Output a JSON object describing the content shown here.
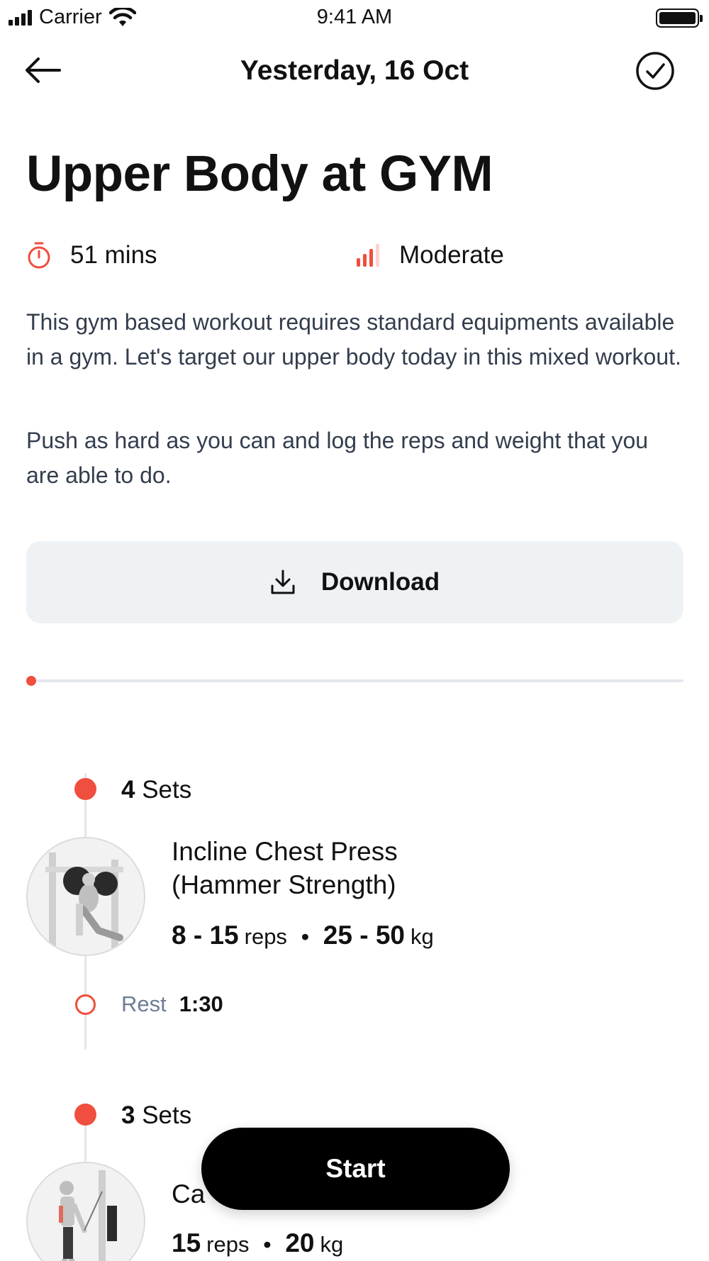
{
  "status_bar": {
    "carrier": "Carrier",
    "time": "9:41 AM"
  },
  "nav": {
    "title": "Yesterday, 16 Oct"
  },
  "workout": {
    "title": "Upper Body at GYM",
    "duration": "51 mins",
    "level": "Moderate",
    "description_1": "This gym based workout requires standard equipments available in a gym. Let's target our upper body today in this mixed workout.",
    "description_2": "Push as hard as you can and log the reps and weight that you are able to do."
  },
  "actions": {
    "download_label": "Download",
    "start_label": "Start"
  },
  "progress": {
    "fraction": 0.0
  },
  "exercises": [
    {
      "sets_count": "4",
      "sets_label": "Sets",
      "name": "Incline Chest Press (Hammer Strength)",
      "reps": "8 - 15",
      "reps_unit": "reps",
      "separator": "•",
      "weight": "25 - 50",
      "weight_unit": "kg",
      "rest_label": "Rest",
      "rest_value": "1:30"
    },
    {
      "sets_count": "3",
      "sets_label": "Sets",
      "name": "Ca",
      "reps": "15",
      "reps_unit": "reps",
      "separator": "•",
      "weight": "20",
      "weight_unit": "kg"
    }
  ],
  "colors": {
    "accent": "#f04e3e",
    "button_bg": "#eff2f5",
    "muted_text": "#6c7d97",
    "body_text": "#333d4d"
  },
  "icons": {
    "back": "arrow-left-icon",
    "done": "check-circle-icon",
    "duration": "stopwatch-icon",
    "level": "signal-bars-icon",
    "download": "download-icon"
  }
}
